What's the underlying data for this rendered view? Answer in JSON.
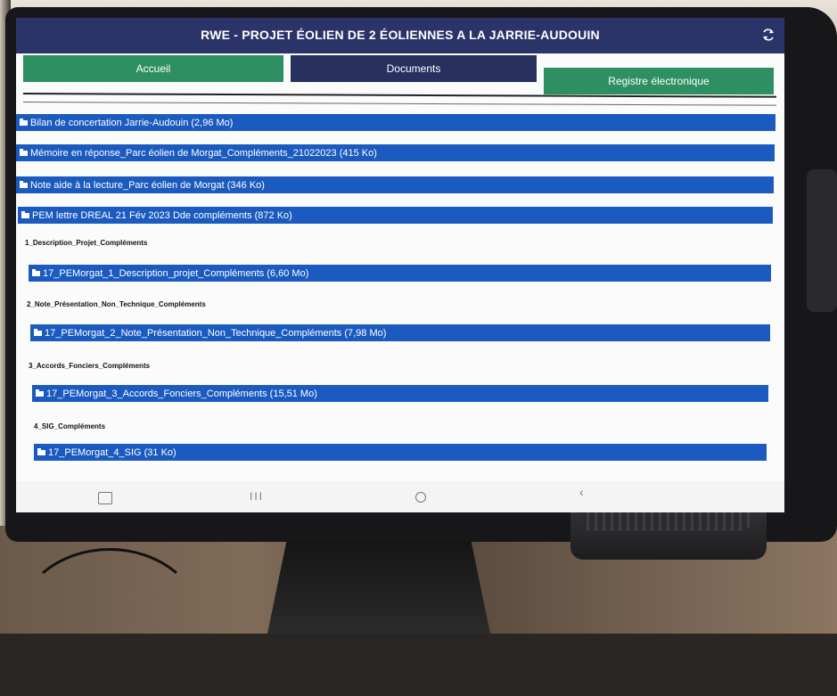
{
  "app": {
    "title": "RWE - PROJET ÉOLIEN DE 2 ÉOLIENNES A LA JARRIE-AUDOUIN"
  },
  "tabs": [
    {
      "label": "Accueil",
      "color": "#2e8f63"
    },
    {
      "label": "Documents",
      "color": "#27305f",
      "active": true
    },
    {
      "label": "Registre électronique",
      "color": "#2e8f63"
    }
  ],
  "documents": [
    {
      "label": "Bilan de concertation Jarrie-Audouin (2,96 Mo)"
    },
    {
      "label": "Mémoire en réponse_Parc éolien de Morgat_Compléments_21022023 (415 Ko)"
    },
    {
      "label": "Note aide à la lecture_Parc éolien de Morgat (346 Ko)"
    },
    {
      "label": "PEM lettre DREAL 21 Fév 2023 Dde compléments (872 Ko)"
    }
  ],
  "sections": [
    {
      "title": "1_Description_Projet_Compléments",
      "file": "17_PEMorgat_1_Description_projet_Compléments (6,60 Mo)"
    },
    {
      "title": "2_Note_Présentation_Non_Technique_Compléments",
      "file": "17_PEMorgat_2_Note_Présentation_Non_Technique_Compléments (7,98 Mo)"
    },
    {
      "title": "3_Accords_Fonciers_Compléments",
      "file": "17_PEMorgat_3_Accords_Fonciers_Compléments (15,51 Mo)"
    },
    {
      "title": "4_SIG_Compléments",
      "file": "17_PEMorgat_4_SIG (31 Ko)"
    }
  ],
  "navbar": {
    "recents": "III",
    "back": "‹"
  },
  "colors": {
    "topbar": "#2b3468",
    "row": "#1b5bbf"
  }
}
